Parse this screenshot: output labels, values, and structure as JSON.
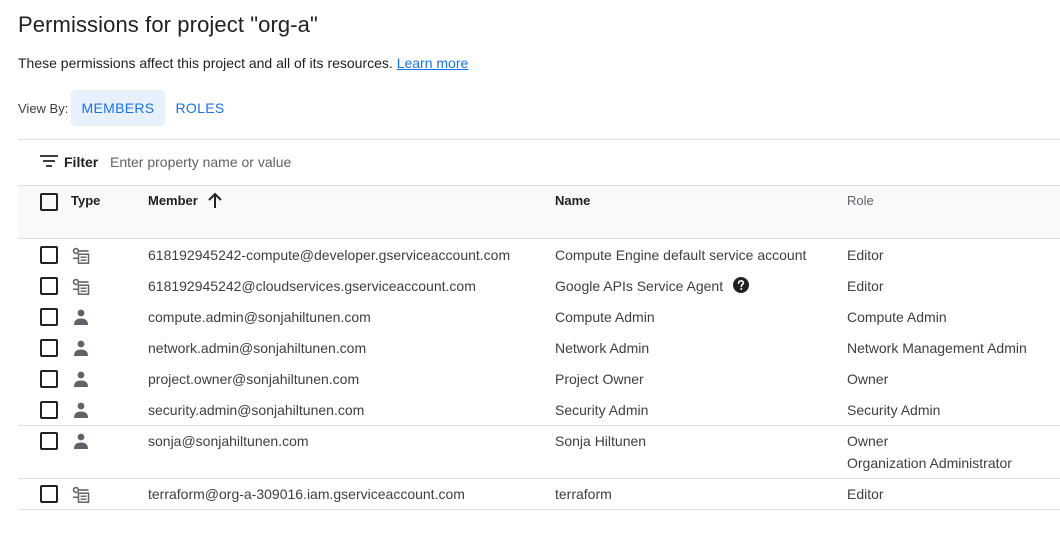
{
  "page": {
    "title": "Permissions for project \"org-a\"",
    "subtitle": "These permissions affect this project and all of its resources.",
    "learn_more": "Learn more"
  },
  "view_by": {
    "label": "View By:",
    "members": "MEMBERS",
    "roles": "ROLES",
    "selected": "MEMBERS"
  },
  "filter": {
    "label": "Filter",
    "placeholder": "Enter property name or value"
  },
  "table": {
    "columns": {
      "type": "Type",
      "member": "Member",
      "name": "Name",
      "role": "Role"
    },
    "sort": {
      "column": "Member",
      "direction": "ascending"
    },
    "rows": [
      {
        "type": "service-account",
        "member": "618192945242-compute@developer.gserviceaccount.com",
        "name": "Compute Engine default service account",
        "roles": [
          "Editor"
        ],
        "help": false
      },
      {
        "type": "service-account",
        "member": "618192945242@cloudservices.gserviceaccount.com",
        "name": "Google APIs Service Agent",
        "roles": [
          "Editor"
        ],
        "help": true
      },
      {
        "type": "user",
        "member": "compute.admin@sonjahiltunen.com",
        "name": "Compute Admin",
        "roles": [
          "Compute Admin"
        ],
        "help": false
      },
      {
        "type": "user",
        "member": "network.admin@sonjahiltunen.com",
        "name": "Network Admin",
        "roles": [
          "Network Management Admin"
        ],
        "help": false
      },
      {
        "type": "user",
        "member": "project.owner@sonjahiltunen.com",
        "name": "Project Owner",
        "roles": [
          "Owner"
        ],
        "help": false
      },
      {
        "type": "user",
        "member": "security.admin@sonjahiltunen.com",
        "name": "Security Admin",
        "roles": [
          "Security Admin"
        ],
        "help": false
      },
      {
        "type": "user",
        "member": "sonja@sonjahiltunen.com",
        "name": "Sonja Hiltunen",
        "roles": [
          "Owner",
          "Organization Administrator"
        ],
        "help": false
      },
      {
        "type": "service-account",
        "member": "terraform@org-a-309016.iam.gserviceaccount.com",
        "name": "terraform",
        "roles": [
          "Editor"
        ],
        "help": false
      }
    ]
  },
  "icons": {
    "filter": "filter-icon",
    "sort": "arrow-up-icon",
    "user": "person-icon",
    "service_account": "service-account-icon",
    "help": "help-circle-icon"
  },
  "colors": {
    "accent": "#1a73e8",
    "selected_tab_bg": "#e8f0fe",
    "text": "#202124",
    "muted": "#5f6368",
    "border": "#dadce0"
  }
}
